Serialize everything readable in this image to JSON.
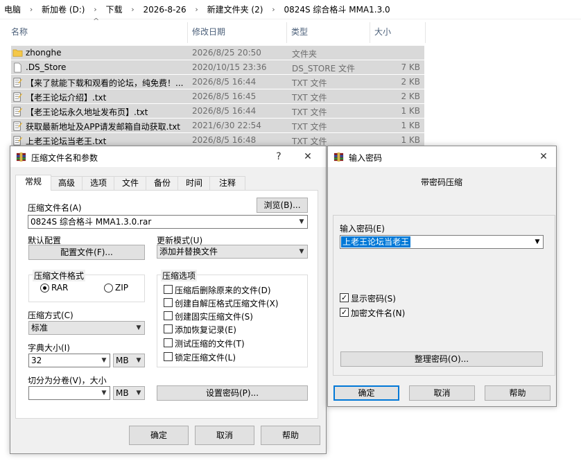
{
  "explorer": {
    "breadcrumb": [
      "电脑",
      "新加卷 (D:)",
      "下载",
      "2026-8-26",
      "新建文件夹 (2)",
      "0824S 综合格斗 MMA1.3.0"
    ],
    "columns": {
      "name": "名称",
      "date": "修改日期",
      "type": "类型",
      "size": "大小"
    },
    "files": [
      {
        "name": "zhonghe",
        "date": "2026/8/25 20:50",
        "type": "文件夹",
        "size": "",
        "icon": "folder-icon"
      },
      {
        "name": ".DS_Store",
        "date": "2020/10/15 23:36",
        "type": "DS_STORE 文件",
        "size": "7 KB",
        "icon": "file-icon"
      },
      {
        "name": "【来了就能下载和观看的论坛，纯免费！...",
        "date": "2026/8/5 16:44",
        "type": "TXT 文件",
        "size": "2 KB",
        "icon": "text-file-icon"
      },
      {
        "name": "【老王论坛介绍】.txt",
        "date": "2026/8/5 16:45",
        "type": "TXT 文件",
        "size": "2 KB",
        "icon": "text-file-icon"
      },
      {
        "name": "【老王论坛永久地址发布页】.txt",
        "date": "2026/8/5 16:44",
        "type": "TXT 文件",
        "size": "1 KB",
        "icon": "text-file-icon"
      },
      {
        "name": "获取最新地址及APP请发邮箱自动获取.txt",
        "date": "2021/6/30 22:54",
        "type": "TXT 文件",
        "size": "1 KB",
        "icon": "text-file-icon"
      },
      {
        "name": "上老王论坛当老王.txt",
        "date": "2026/8/5 16:48",
        "type": "TXT 文件",
        "size": "1 KB",
        "icon": "text-file-icon"
      }
    ]
  },
  "archive_dialog": {
    "title": "压缩文件名和参数",
    "help_glyph": "?",
    "close_glyph": "✕",
    "tabs": [
      "常规",
      "高级",
      "选项",
      "文件",
      "备份",
      "时间",
      "注释"
    ],
    "archive_name_label": "压缩文件名(A)",
    "browse_label": "浏览(B)...",
    "archive_name_value": "0824S 综合格斗 MMA1.3.0.rar",
    "default_profile_label": "默认配置",
    "profiles_button": "配置文件(F)...",
    "update_mode_label": "更新模式(U)",
    "update_mode_value": "添加并替换文件",
    "format_group_label": "压缩文件格式",
    "format_rar": "RAR",
    "format_zip": "ZIP",
    "options_group_label": "压缩选项",
    "options": [
      "压缩后删除原来的文件(D)",
      "创建自解压格式压缩文件(X)",
      "创建固实压缩文件(S)",
      "添加恢复记录(E)",
      "测试压缩的文件(T)",
      "锁定压缩文件(L)"
    ],
    "method_label": "压缩方式(C)",
    "method_value": "标准",
    "dict_label": "字典大小(I)",
    "dict_value": "32",
    "dict_unit": "MB",
    "split_label": "切分为分卷(V)，大小",
    "split_value": "",
    "split_unit": "MB",
    "set_password_button": "设置密码(P)...",
    "ok": "确定",
    "cancel": "取消",
    "help": "帮助"
  },
  "password_dialog": {
    "title": "输入密码",
    "close_glyph": "✕",
    "heading": "带密码压缩",
    "enter_label": "输入密码(E)",
    "password_value": "上老王论坛当老王",
    "show_password_label": "显示密码(S)",
    "encrypt_names_label": "加密文件名(N)",
    "organize_button": "整理密码(O)...",
    "ok": "确定",
    "cancel": "取消",
    "help": "帮助"
  }
}
